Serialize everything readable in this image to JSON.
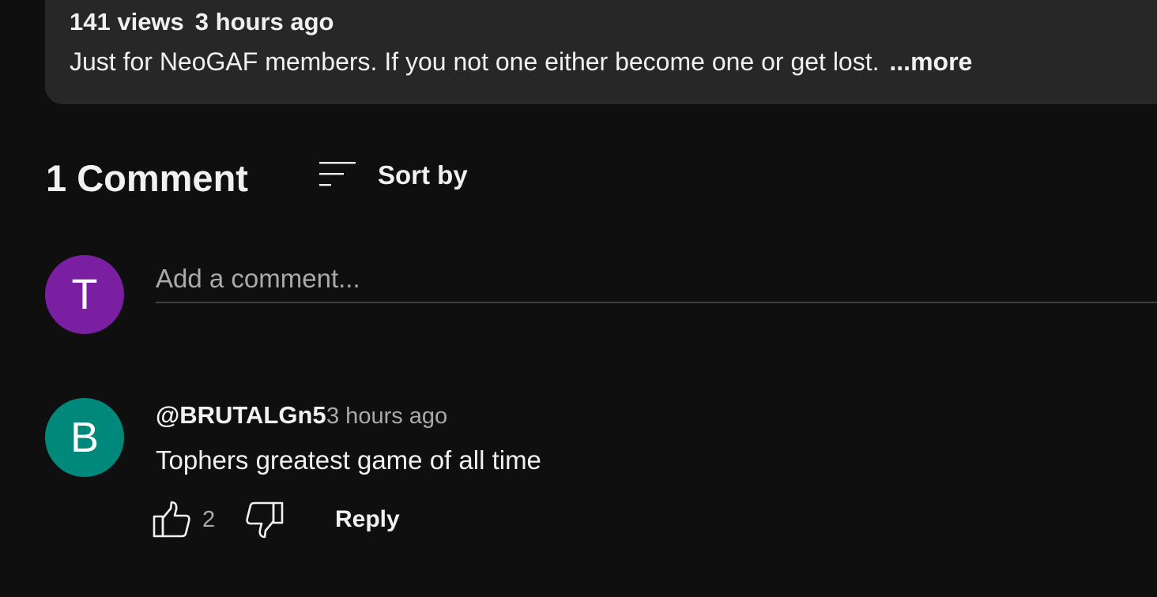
{
  "description": {
    "views": "141 views",
    "time": "3 hours ago",
    "text": "Just for NeoGAF members. If you not one either become one or get lost.",
    "more_label": "...more"
  },
  "comments_header": {
    "count_label": "1 Comment",
    "sort_label": "Sort by",
    "sort_icon": "sort-icon"
  },
  "add_comment": {
    "avatar_letter": "T",
    "avatar_color": "#7b1fa2",
    "placeholder": "Add a comment..."
  },
  "comments": [
    {
      "avatar_letter": "B",
      "avatar_color": "#00897b",
      "author": "@BRUTALGn5",
      "published": "3 hours ago",
      "text": "Tophers greatest game of all time",
      "like_count": "2",
      "like_icon": "thumbs-up-icon",
      "dislike_icon": "thumbs-down-icon",
      "reply_label": "Reply"
    }
  ],
  "colors": {
    "background": "#0f0f0f",
    "description_box": "#272727",
    "primary_text": "#f1f1f1",
    "secondary_text": "#aaaaaa"
  }
}
